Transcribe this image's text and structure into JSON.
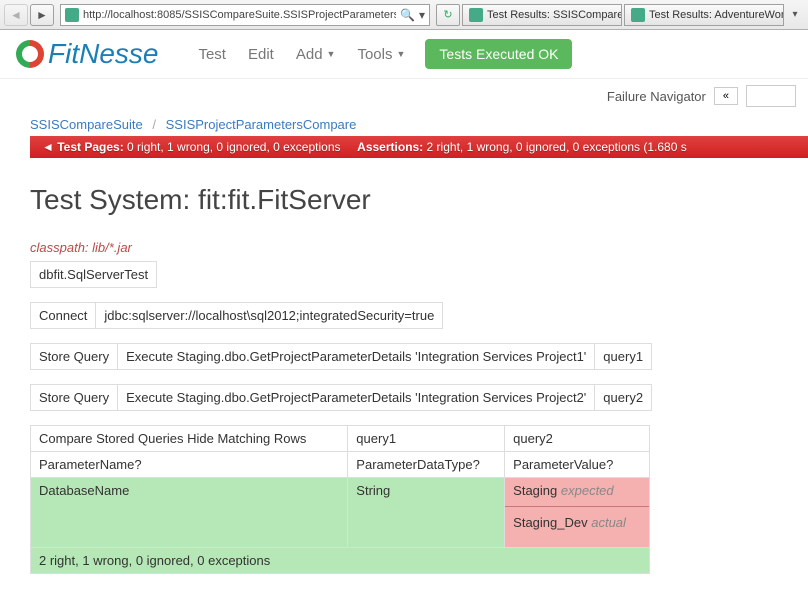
{
  "browser": {
    "url": "http://localhost:8085/SSISCompareSuite.SSISProjectParametersComp...",
    "tabs": [
      {
        "label": "Test Results: SSISCompareS..."
      },
      {
        "label": "Test Results: AdventureWorksS..."
      }
    ]
  },
  "header": {
    "logo_text": "FitNesse",
    "menu": {
      "test": "Test",
      "edit": "Edit",
      "add": "Add",
      "tools": "Tools"
    },
    "tests_ok": "Tests Executed OK"
  },
  "fail_nav": {
    "label": "Failure Navigator",
    "prev": "«"
  },
  "breadcrumb": {
    "a": "SSISCompareSuite",
    "b": "SSISProjectParametersCompare"
  },
  "assert_bar": {
    "pages_label": "Test Pages:",
    "pages_text": "0 right, 1 wrong, 0 ignored, 0 exceptions",
    "assert_label": "Assertions:",
    "assert_text": "2 right, 1 wrong, 0 ignored, 0 exceptions (1.680 s"
  },
  "page_title": "Test System: fit:fit.FitServer",
  "classpath": "classpath: lib/*.jar",
  "t_fixture": {
    "cell": "dbfit.SqlServerTest"
  },
  "t_connect": {
    "a": "Connect",
    "b": "jdbc:sqlserver://localhost\\sql2012;integratedSecurity=true"
  },
  "t_sq1": {
    "a": "Store Query",
    "b": "Execute Staging.dbo.GetProjectParameterDetails 'Integration Services Project1'",
    "c": "query1"
  },
  "t_sq2": {
    "a": "Store Query",
    "b": "Execute Staging.dbo.GetProjectParameterDetails 'Integration Services Project2'",
    "c": "query2"
  },
  "t_compare": {
    "header": {
      "a": "Compare Stored Queries Hide Matching Rows",
      "b": "query1",
      "c": "query2"
    },
    "cols": {
      "a": "ParameterName?",
      "b": "ParameterDataType?",
      "c": "ParameterValue?"
    },
    "row": {
      "name": "DatabaseName",
      "type": "String",
      "expected": "Staging",
      "expected_label": "expected",
      "actual": "Staging_Dev",
      "actual_label": "actual"
    },
    "summary": "2 right, 1 wrong, 0 ignored, 0 exceptions"
  }
}
